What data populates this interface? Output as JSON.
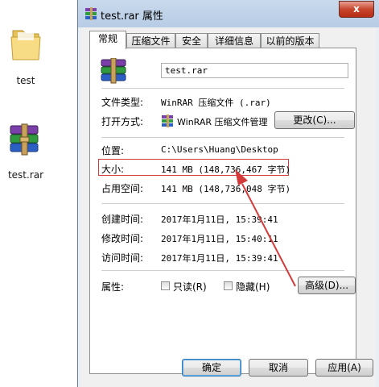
{
  "desktop": {
    "icons": [
      {
        "label": "test"
      },
      {
        "label": "test.rar"
      }
    ]
  },
  "window": {
    "title": "test.rar 属性",
    "close_label": "x"
  },
  "tabs": [
    {
      "label": "常规"
    },
    {
      "label": "压缩文件"
    },
    {
      "label": "安全"
    },
    {
      "label": "详细信息"
    },
    {
      "label": "以前的版本"
    }
  ],
  "general": {
    "file_name": "test.rar",
    "type_label": "文件类型:",
    "type_value": "WinRAR 压缩文件 (.rar)",
    "open_label": "打开方式:",
    "open_value": "WinRAR 压缩文件管理",
    "change_button": "更改(C)...",
    "location_label": "位置:",
    "location_value": "C:\\Users\\Huang\\Desktop",
    "size_label": "大小:",
    "size_value": "141 MB (148,736,467 字节)",
    "disk_size_label": "占用空间:",
    "disk_size_value": "141 MB (148,736,048 字节)",
    "created_label": "创建时间:",
    "created_value": "2017年1月11日, 15:39:41",
    "modified_label": "修改时间:",
    "modified_value": "2017年1月11日, 15:40:11",
    "accessed_label": "访问时间:",
    "accessed_value": "2017年1月11日, 15:39:41",
    "attributes_label": "属性:",
    "readonly_label": "只读(R)",
    "hidden_label": "隐藏(H)",
    "advanced_button": "高级(D)..."
  },
  "footer": {
    "ok_button": "确定",
    "cancel_button": "取消",
    "apply_button": "应用(A)"
  },
  "colors": {
    "annotation": "#d43a3a"
  }
}
